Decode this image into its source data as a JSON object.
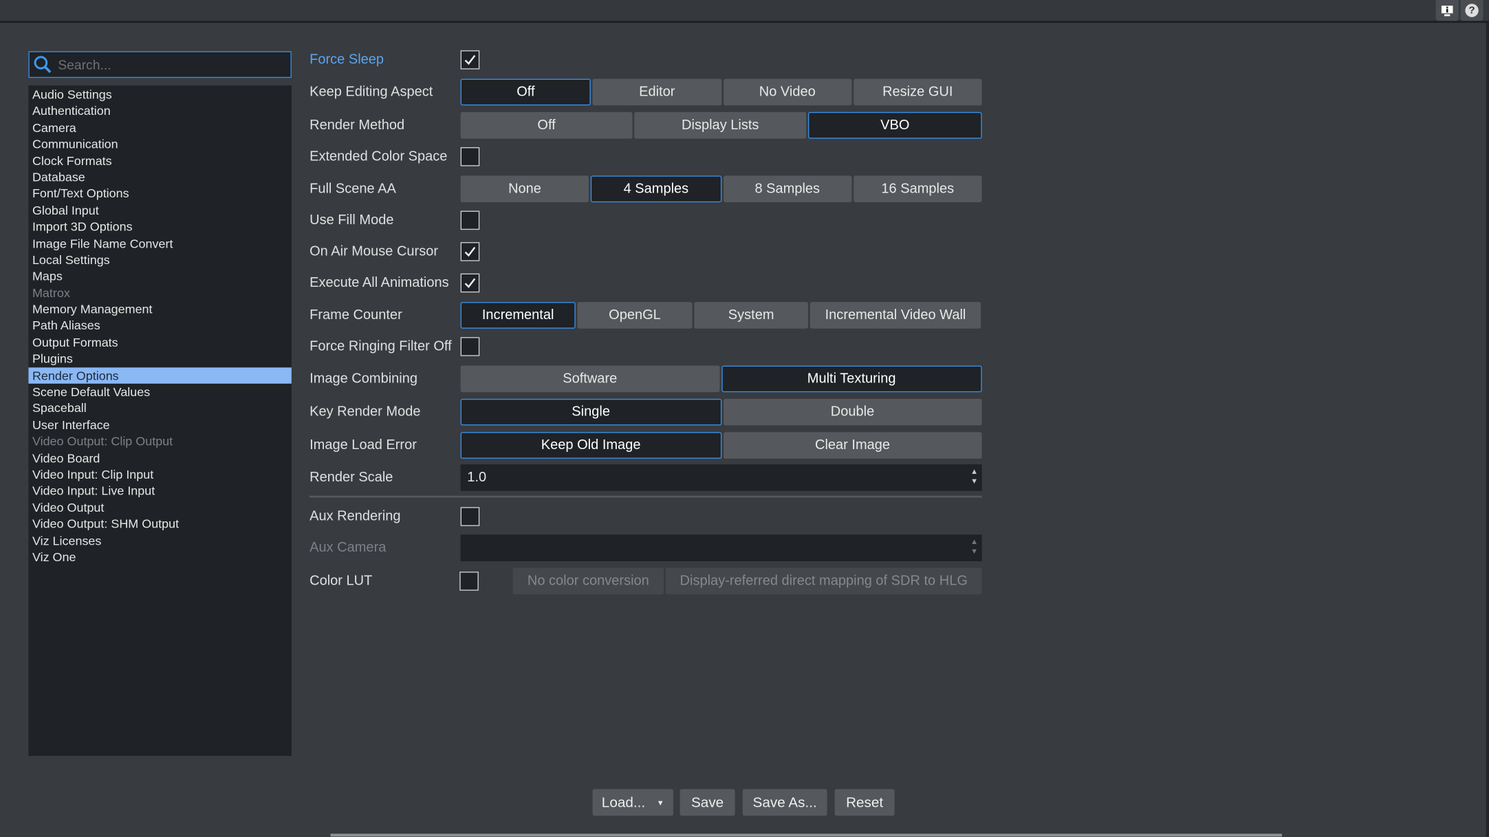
{
  "topbar": {
    "icons": [
      "monitor-info-icon",
      "help-icon"
    ]
  },
  "search": {
    "placeholder": "Search..."
  },
  "sidebar": {
    "selected": "Render Options",
    "items": [
      {
        "label": "Audio Settings"
      },
      {
        "label": "Authentication"
      },
      {
        "label": "Camera"
      },
      {
        "label": "Communication"
      },
      {
        "label": "Clock Formats"
      },
      {
        "label": "Database"
      },
      {
        "label": "Font/Text Options"
      },
      {
        "label": "Global Input"
      },
      {
        "label": "Import 3D Options"
      },
      {
        "label": "Image File Name Convert"
      },
      {
        "label": "Local Settings"
      },
      {
        "label": "Maps"
      },
      {
        "label": "Matrox",
        "disabled": true
      },
      {
        "label": "Memory Management"
      },
      {
        "label": "Path Aliases"
      },
      {
        "label": "Output Formats"
      },
      {
        "label": "Plugins"
      },
      {
        "label": "Render Options",
        "selected": true
      },
      {
        "label": "Scene Default Values"
      },
      {
        "label": "Spaceball"
      },
      {
        "label": "User Interface"
      },
      {
        "label": "Video Output: Clip Output",
        "disabled": true
      },
      {
        "label": "Video Board"
      },
      {
        "label": "Video Input: Clip Input"
      },
      {
        "label": "Video Input: Live Input"
      },
      {
        "label": "Video Output"
      },
      {
        "label": "Video Output: SHM Output"
      },
      {
        "label": "Viz Licenses"
      },
      {
        "label": "Viz One"
      }
    ]
  },
  "settings": [
    {
      "label": "Force Sleep",
      "type": "checkbox",
      "checked": true,
      "highlight": true
    },
    {
      "label": "Keep Editing Aspect",
      "type": "buttons",
      "options": [
        "Off",
        "Editor",
        "No Video",
        "Resize GUI"
      ],
      "selected": "Off"
    },
    {
      "label": "Render Method",
      "type": "buttons",
      "options": [
        "Off",
        "Display Lists",
        "VBO"
      ],
      "selected": "VBO"
    },
    {
      "label": "Extended Color Space",
      "type": "checkbox",
      "checked": false
    },
    {
      "label": "Full Scene AA",
      "type": "buttons",
      "options": [
        "None",
        "4 Samples",
        "8 Samples",
        "16 Samples"
      ],
      "selected": "4 Samples"
    },
    {
      "label": "Use Fill Mode",
      "type": "checkbox",
      "checked": false
    },
    {
      "label": "On Air Mouse Cursor",
      "type": "checkbox",
      "checked": true
    },
    {
      "label": "Execute All Animations",
      "type": "checkbox",
      "checked": true
    },
    {
      "label": "Frame Counter",
      "type": "buttons",
      "options": [
        "Incremental",
        "OpenGL",
        "System",
        "Incremental Video Wall"
      ],
      "selected": "Incremental"
    },
    {
      "label": "Force Ringing Filter Off",
      "type": "checkbox",
      "checked": false
    },
    {
      "label": "Image Combining",
      "type": "buttons",
      "options": [
        "Software",
        "Multi Texturing"
      ],
      "selected": "Multi Texturing"
    },
    {
      "label": "Key Render Mode",
      "type": "buttons",
      "options": [
        "Single",
        "Double"
      ],
      "selected": "Single"
    },
    {
      "label": "Image Load Error",
      "type": "buttons",
      "options": [
        "Keep Old Image",
        "Clear Image"
      ],
      "selected": "Keep Old Image"
    },
    {
      "label": "Render Scale",
      "type": "spinbox",
      "value": "1.0"
    },
    {
      "label": "Aux Rendering",
      "type": "checkbox",
      "checked": false
    },
    {
      "label": "Aux Camera",
      "type": "spinbox",
      "value": "",
      "disabled": true
    },
    {
      "label": "Color LUT",
      "type": "checkbox-buttons",
      "checked": false,
      "options": [
        "No color conversion",
        "Display-referred direct mapping of SDR to HLG"
      ],
      "disabled": true
    }
  ],
  "footer": {
    "load": "Load...",
    "save": "Save",
    "save_as": "Save As...",
    "reset": "Reset"
  },
  "colors": {
    "accent": "#3a8ee6",
    "selected_item": "#8ab8f5",
    "panel": "#1f2226",
    "background": "#383b40",
    "button": "#55585c"
  }
}
